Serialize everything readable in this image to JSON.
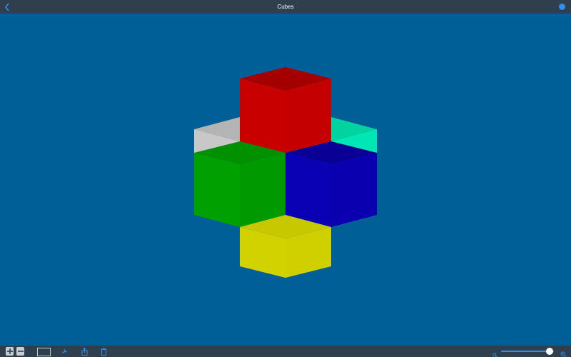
{
  "window": {
    "title": "Cubes"
  },
  "icons": {
    "back": "chevron-left-icon",
    "globe": "globe-icon",
    "add": "plus-icon",
    "remove": "minus-icon",
    "palette": "color-swatch-icon",
    "fan": "fan-icon",
    "share": "share-icon",
    "trash": "trash-icon",
    "zoom_out": "zoom-out-icon",
    "zoom_in": "zoom-in-icon"
  },
  "colors": {
    "background": "#005f96",
    "bars": "#2f3f4d",
    "accent": "#2d8ff0",
    "cubes": [
      "#c80000",
      "#00a000",
      "#0a00b4",
      "#d2d200",
      "#aaaaaa",
      "#00d2a0"
    ]
  },
  "zoom": {
    "value": 0.92
  }
}
